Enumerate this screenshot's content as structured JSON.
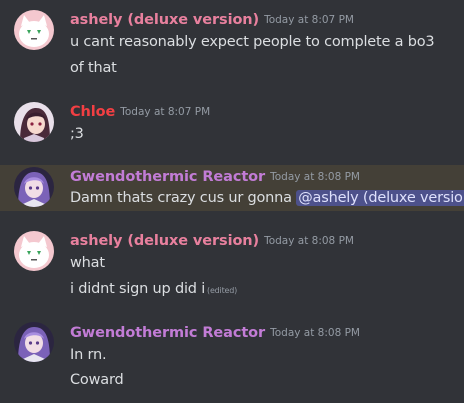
{
  "theme": {
    "background": "#313338",
    "highlight_background": "#444037",
    "text": "#dbdee1",
    "muted": "#949ba4",
    "mention_bg": "#5865f2"
  },
  "messages": [
    {
      "author": "ashely (deluxe version)",
      "author_color": "#e8809e",
      "avatar": "white-cat-avatar",
      "timestamp": "Today at 8:07 PM",
      "lines": [
        "u cant reasonably expect people to complete a bo3",
        "of that"
      ]
    },
    {
      "author": "Chloe",
      "author_color": "#f23f43",
      "avatar": "anime-girl-avatar",
      "timestamp": "Today at 8:07 PM",
      "lines": [
        ";3"
      ]
    },
    {
      "author": "Gwendothermic Reactor",
      "author_color": "#c27cd6",
      "avatar": "purple-hair-avatar",
      "timestamp": "Today at 8:08 PM",
      "lines": [
        "Damn thats crazy cus ur gonna "
      ],
      "mention": "@ashely (deluxe version)",
      "highlighted": true
    },
    {
      "author": "ashely (deluxe version)",
      "author_color": "#e8809e",
      "avatar": "white-cat-avatar",
      "timestamp": "Today at 8:08 PM",
      "lines": [
        "what",
        "i didnt sign up did i"
      ],
      "edited_label": "(edited)"
    },
    {
      "author": "Gwendothermic Reactor",
      "author_color": "#c27cd6",
      "avatar": "purple-hair-avatar",
      "timestamp": "Today at 8:08 PM",
      "lines": [
        "In rn.",
        "Coward"
      ]
    }
  ]
}
